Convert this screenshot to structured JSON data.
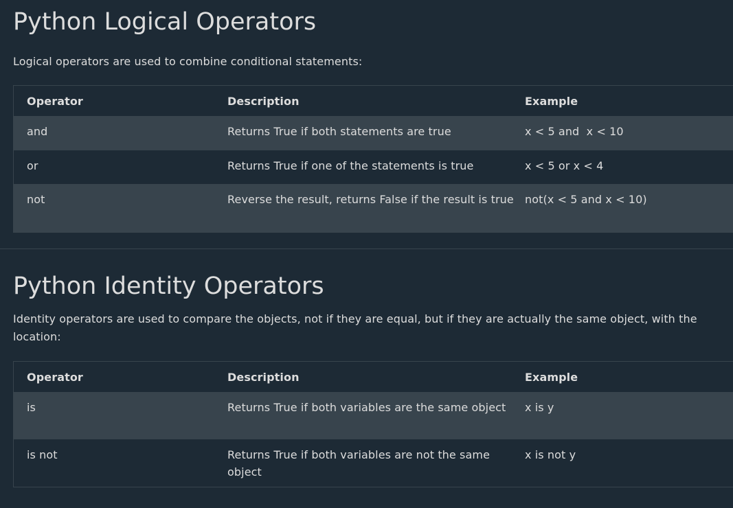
{
  "logical": {
    "title": "Python Logical Operators",
    "intro": "Logical operators are used to combine conditional statements:",
    "headers": {
      "operator": "Operator",
      "description": "Description",
      "example": "Example"
    },
    "rows": [
      {
        "operator": "and",
        "description": "Returns True if both statements are true",
        "example": "x < 5 and  x < 10"
      },
      {
        "operator": "or",
        "description": "Returns True if one of the statements is true",
        "example": "x < 5 or x < 4"
      },
      {
        "operator": "not",
        "description": "Reverse the result, returns False if the result is true",
        "example": "not(x < 5 and x < 10)"
      }
    ]
  },
  "identity": {
    "title": "Python Identity Operators",
    "intro_line1": "Identity operators are used to compare the objects, not if they are equal, but if they are actually the same object, with the",
    "intro_line2": "location:",
    "headers": {
      "operator": "Operator",
      "description": "Description",
      "example": "Example"
    },
    "rows": [
      {
        "operator": "is",
        "description": "Returns True if both variables are the same object",
        "example": "x is y"
      },
      {
        "operator": "is not",
        "description": "Returns True if both variables are not the same object",
        "example": "x is not y"
      }
    ]
  }
}
